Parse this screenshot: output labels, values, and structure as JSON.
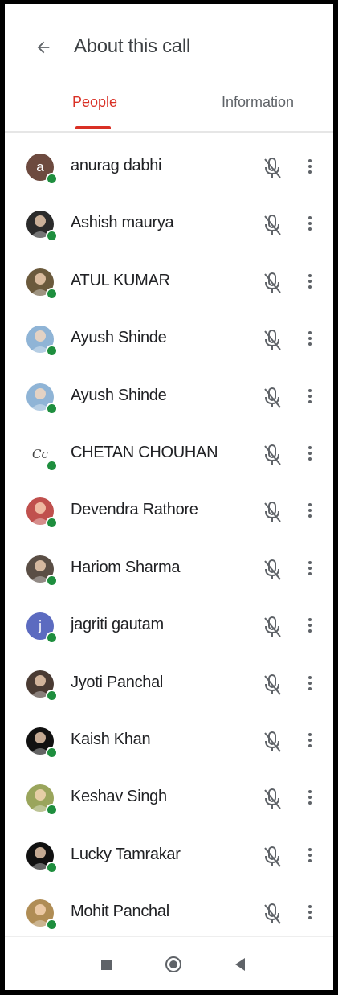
{
  "header": {
    "title": "About this call",
    "back_icon": "arrow-left-icon"
  },
  "tabs": [
    {
      "label": "People",
      "active": true
    },
    {
      "label": "Information",
      "active": false
    }
  ],
  "colors": {
    "accent": "#d93025",
    "online": "#1e8e3e",
    "icon": "#5f6368"
  },
  "participants": [
    {
      "name": "anurag dabhi",
      "avatar": {
        "type": "letter",
        "letter": "a",
        "bg": "#6d4a3f"
      }
    },
    {
      "name": "Ashish maurya",
      "avatar": {
        "type": "photo",
        "bg": "#2b2b2b"
      }
    },
    {
      "name": "ATUL KUMAR",
      "avatar": {
        "type": "photo",
        "bg": "#6b5a3c"
      }
    },
    {
      "name": "Ayush Shinde",
      "avatar": {
        "type": "photo",
        "bg": "#8fb4d6"
      }
    },
    {
      "name": "Ayush Shinde",
      "avatar": {
        "type": "photo",
        "bg": "#8fb4d6"
      }
    },
    {
      "name": "CHETAN CHOUHAN",
      "avatar": {
        "type": "text",
        "letter": "Cc",
        "bg": "#ffffff"
      }
    },
    {
      "name": "Devendra Rathore",
      "avatar": {
        "type": "photo",
        "bg": "#c0504d"
      }
    },
    {
      "name": "Hariom Sharma",
      "avatar": {
        "type": "photo",
        "bg": "#5a4e45"
      }
    },
    {
      "name": "jagriti gautam",
      "avatar": {
        "type": "letter",
        "letter": "j",
        "bg": "#5c6bc0"
      }
    },
    {
      "name": "Jyoti Panchal",
      "avatar": {
        "type": "photo",
        "bg": "#4a3b33"
      }
    },
    {
      "name": "Kaish Khan",
      "avatar": {
        "type": "photo",
        "bg": "#111111"
      }
    },
    {
      "name": "Keshav Singh",
      "avatar": {
        "type": "photo",
        "bg": "#9aa55c"
      }
    },
    {
      "name": "Lucky Tamrakar",
      "avatar": {
        "type": "photo",
        "bg": "#111111"
      }
    },
    {
      "name": "Mohit Panchal",
      "avatar": {
        "type": "photo",
        "bg": "#b08d55"
      }
    }
  ],
  "row_icons": {
    "mic": "mic-off-icon",
    "more": "more-vert-icon"
  },
  "navbar": {
    "icons": [
      "recent-apps-icon",
      "home-icon",
      "back-icon"
    ]
  }
}
